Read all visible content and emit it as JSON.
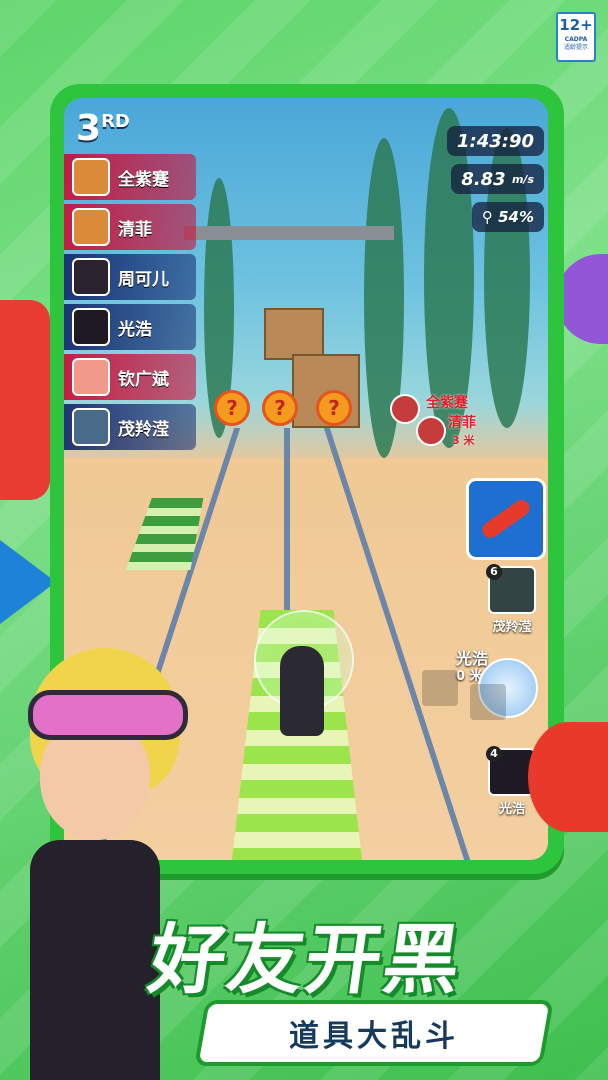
{
  "age_badge": {
    "rating": "12+",
    "org": "CADPA",
    "label": "适龄提示"
  },
  "hud": {
    "place_number": "3",
    "place_suffix": "RD",
    "timer": "1:43:90",
    "speed": "8.83",
    "speed_unit": "m/s",
    "progress": "54%"
  },
  "players": [
    {
      "name": "全紫蹇",
      "highlight": true
    },
    {
      "name": "清菲",
      "highlight": true
    },
    {
      "name": "周可儿",
      "highlight": false
    },
    {
      "name": "光浩",
      "highlight": false
    },
    {
      "name": "钦广斌",
      "highlight": true
    },
    {
      "name": "茂羚滢",
      "highlight": false
    }
  ],
  "mystery_boxes": [
    "?",
    "?",
    "?"
  ],
  "rival_tags": {
    "first": "全紫蹇",
    "second": "清菲",
    "distance": "3 米"
  },
  "item_slot": {
    "icon": "hoverboard-icon"
  },
  "side_cards": [
    {
      "rank": "6",
      "name": "茂羚滢"
    },
    {
      "rank": "4",
      "name": "光浩"
    }
  ],
  "floating_label": {
    "name": "光浩",
    "value": "0 米"
  },
  "headline": "好友开黑",
  "subheadline": "道具大乱斗",
  "colors": {
    "frame": "#2fc43e",
    "headline_outline": "#148a2a",
    "highlight_row": "#c8143c",
    "default_row": "#14286e"
  }
}
